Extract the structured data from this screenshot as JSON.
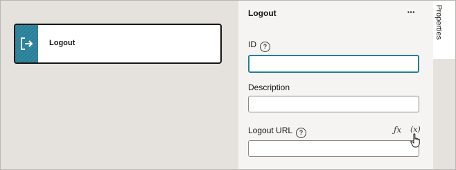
{
  "canvas": {
    "node": {
      "label": "Logout",
      "icon": "logout-icon"
    }
  },
  "panel": {
    "title": "Logout",
    "more_label": "···",
    "fields": {
      "id": {
        "label": "ID",
        "value": ""
      },
      "description": {
        "label": "Description",
        "value": ""
      },
      "logout_url": {
        "label": "Logout URL",
        "value": "",
        "fx_label": "ƒx",
        "var_label": "(x)"
      }
    },
    "help_glyph": "?"
  },
  "rail": {
    "tab_properties": "Properties"
  },
  "colors": {
    "canvas_bg": "#e5e2dd",
    "panel_bg": "#f5f4f2",
    "node_accent": "#2a7d96",
    "focus_border": "#227e9e"
  }
}
